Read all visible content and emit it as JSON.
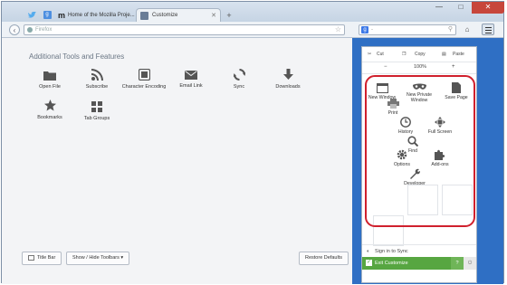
{
  "tabs": [
    {
      "label": "",
      "icon": "twitter-icon",
      "color": "#55acee"
    },
    {
      "label": "",
      "icon": "google-icon",
      "color": "#4d8fe0"
    },
    {
      "label": "Home of the Mozilla Proje...",
      "icon": "mozilla-icon",
      "color": "#222222"
    },
    {
      "label": "Customize",
      "icon": "customize-icon",
      "color": "#6a7d97"
    }
  ],
  "window_controls": {
    "minimize": "—",
    "maximize": "□",
    "close": "✕"
  },
  "navbar": {
    "url_placeholder": "Firefox",
    "search_engine": "g",
    "search_placeholder": "-"
  },
  "palette": {
    "title": "Additional Tools and Features",
    "items": [
      {
        "label": "Open File",
        "icon": "folder-icon"
      },
      {
        "label": "Subscribe",
        "icon": "rss-icon"
      },
      {
        "label": "Character Encoding",
        "icon": "character-encoding-icon"
      },
      {
        "label": "Email Link",
        "icon": "envelope-icon"
      },
      {
        "label": "Sync",
        "icon": "sync-icon"
      },
      {
        "label": "Downloads",
        "icon": "download-icon"
      },
      {
        "label": "Bookmarks",
        "icon": "star-icon"
      },
      {
        "label": "Tab Groups",
        "icon": "tab-groups-icon"
      }
    ]
  },
  "footer": {
    "title_bar": "Title Bar",
    "show_hide_toolbars": "Show / Hide Toolbars ▾",
    "restore_defaults": "Restore Defaults"
  },
  "menu_panel": {
    "cut": "Cut",
    "copy": "Copy",
    "paste": "Paste",
    "zoom_out": "−",
    "zoom_level": "100%",
    "zoom_in": "+",
    "items": [
      {
        "label": "New Window",
        "icon": "new-window-icon"
      },
      {
        "label": "New Private Window",
        "icon": "private-mask-icon"
      },
      {
        "label": "Save Page",
        "icon": "save-page-icon"
      },
      {
        "label": "Print",
        "icon": "print-icon"
      },
      {
        "label": "History",
        "icon": "clock-icon"
      },
      {
        "label": "Full Screen",
        "icon": "fullscreen-icon"
      },
      {
        "label": "Find",
        "icon": "magnifier-icon"
      },
      {
        "label": "Options",
        "icon": "gear-icon"
      },
      {
        "label": "Add-ons",
        "icon": "puzzle-icon"
      },
      {
        "label": "Developer",
        "icon": "wrench-icon"
      }
    ],
    "sign_in": "Sign in to Sync",
    "exit": "Exit Customize",
    "help": "?",
    "power": "⏻"
  },
  "colors": {
    "side_bg": "#2f6fc4",
    "exit_green": "#57a641",
    "highlight_ring": "#d0202d"
  }
}
